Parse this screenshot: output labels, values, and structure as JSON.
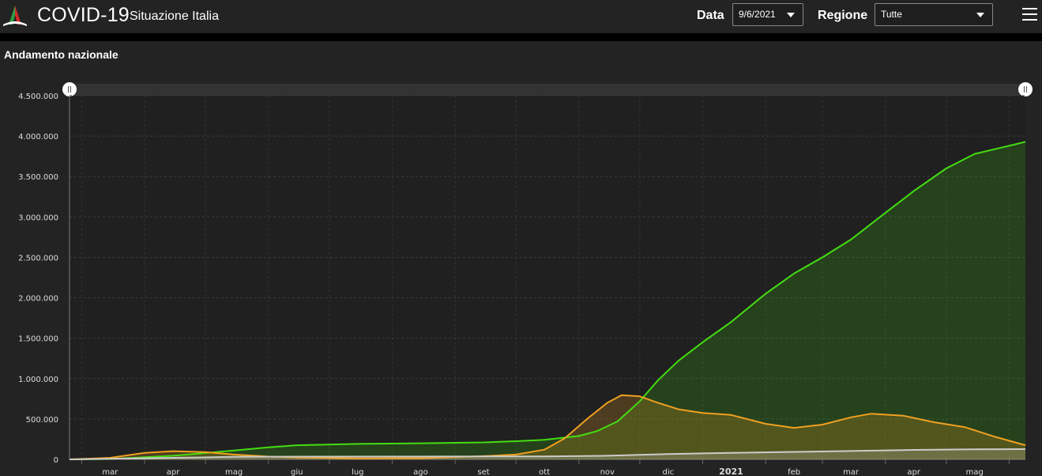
{
  "header": {
    "app_title": "COVID-19",
    "app_subtitle": "Situazione Italia",
    "data_label": "Data",
    "data_value": "9/6/2021",
    "regione_label": "Regione",
    "regione_value": "Tutte",
    "menu_icon": "hamburger-menu-icon",
    "logo_icon": "italy-tricolor-logo"
  },
  "section": {
    "title": "Andamento nazionale"
  },
  "colors": {
    "background": "#232323",
    "plot_background": "#202020",
    "green_series": "#44dd11",
    "orange_series": "#f0a020",
    "white_series": "#cccccc"
  },
  "chart_data": {
    "type": "area",
    "title": "",
    "xlabel": "",
    "ylabel": "",
    "ylim": [
      0,
      4500000
    ],
    "yticks": [
      {
        "value": 0,
        "label": "0"
      },
      {
        "value": 500000,
        "label": "500.000"
      },
      {
        "value": 1000000,
        "label": "1.000.000"
      },
      {
        "value": 1500000,
        "label": "1.500.000"
      },
      {
        "value": 2000000,
        "label": "2.000.000"
      },
      {
        "value": 2500000,
        "label": "2.500.000"
      },
      {
        "value": 3000000,
        "label": "3.000.000"
      },
      {
        "value": 3500000,
        "label": "3.500.000"
      },
      {
        "value": 4000000,
        "label": "4.000.000"
      },
      {
        "value": 4500000,
        "label": "4.500.000"
      }
    ],
    "xlim": [
      "2020-02-24",
      "2021-06-09"
    ],
    "xticks": [
      {
        "date": "2020-03-15",
        "label": "mar",
        "bold": false
      },
      {
        "date": "2020-04-15",
        "label": "apr",
        "bold": false
      },
      {
        "date": "2020-05-15",
        "label": "mag",
        "bold": false
      },
      {
        "date": "2020-06-15",
        "label": "giu",
        "bold": false
      },
      {
        "date": "2020-07-15",
        "label": "lug",
        "bold": false
      },
      {
        "date": "2020-08-15",
        "label": "ago",
        "bold": false
      },
      {
        "date": "2020-09-15",
        "label": "set",
        "bold": false
      },
      {
        "date": "2020-10-15",
        "label": "ott",
        "bold": false
      },
      {
        "date": "2020-11-15",
        "label": "nov",
        "bold": false
      },
      {
        "date": "2020-12-15",
        "label": "dic",
        "bold": false
      },
      {
        "date": "2021-01-15",
        "label": "2021",
        "bold": true
      },
      {
        "date": "2021-02-15",
        "label": "feb",
        "bold": false
      },
      {
        "date": "2021-03-15",
        "label": "mar",
        "bold": false
      },
      {
        "date": "2021-04-15",
        "label": "apr",
        "bold": false
      },
      {
        "date": "2021-05-15",
        "label": "mag",
        "bold": false
      }
    ],
    "grid": true,
    "series": [
      {
        "color": "#44dd11",
        "points": [
          [
            "2020-02-24",
            0
          ],
          [
            "2020-03-15",
            5000
          ],
          [
            "2020-04-15",
            45000
          ],
          [
            "2020-05-15",
            110000
          ],
          [
            "2020-06-01",
            150000
          ],
          [
            "2020-06-15",
            175000
          ],
          [
            "2020-07-15",
            192000
          ],
          [
            "2020-08-15",
            200000
          ],
          [
            "2020-09-15",
            210000
          ],
          [
            "2020-10-01",
            225000
          ],
          [
            "2020-10-15",
            242000
          ],
          [
            "2020-11-01",
            290000
          ],
          [
            "2020-11-10",
            350000
          ],
          [
            "2020-11-20",
            470000
          ],
          [
            "2020-12-01",
            720000
          ],
          [
            "2020-12-10",
            980000
          ],
          [
            "2020-12-20",
            1220000
          ],
          [
            "2021-01-01",
            1450000
          ],
          [
            "2021-01-15",
            1700000
          ],
          [
            "2021-02-01",
            2050000
          ],
          [
            "2021-02-15",
            2300000
          ],
          [
            "2021-03-01",
            2500000
          ],
          [
            "2021-03-15",
            2720000
          ],
          [
            "2021-04-01",
            3050000
          ],
          [
            "2021-04-15",
            3320000
          ],
          [
            "2021-05-01",
            3600000
          ],
          [
            "2021-05-15",
            3780000
          ],
          [
            "2021-06-01",
            3880000
          ],
          [
            "2021-06-09",
            3930000
          ]
        ]
      },
      {
        "color": "#f0a020",
        "points": [
          [
            "2020-02-24",
            0
          ],
          [
            "2020-03-15",
            20000
          ],
          [
            "2020-04-01",
            80000
          ],
          [
            "2020-04-15",
            102000
          ],
          [
            "2020-05-01",
            90000
          ],
          [
            "2020-05-15",
            60000
          ],
          [
            "2020-06-01",
            35000
          ],
          [
            "2020-06-15",
            24000
          ],
          [
            "2020-07-15",
            13000
          ],
          [
            "2020-08-15",
            15000
          ],
          [
            "2020-09-15",
            40000
          ],
          [
            "2020-10-01",
            60000
          ],
          [
            "2020-10-15",
            120000
          ],
          [
            "2020-10-25",
            260000
          ],
          [
            "2020-11-05",
            500000
          ],
          [
            "2020-11-15",
            700000
          ],
          [
            "2020-11-22",
            795000
          ],
          [
            "2020-12-01",
            780000
          ],
          [
            "2020-12-10",
            700000
          ],
          [
            "2020-12-20",
            620000
          ],
          [
            "2021-01-01",
            575000
          ],
          [
            "2021-01-15",
            550000
          ],
          [
            "2021-02-01",
            440000
          ],
          [
            "2021-02-15",
            390000
          ],
          [
            "2021-03-01",
            430000
          ],
          [
            "2021-03-15",
            520000
          ],
          [
            "2021-03-25",
            565000
          ],
          [
            "2021-04-10",
            540000
          ],
          [
            "2021-04-25",
            460000
          ],
          [
            "2021-05-10",
            400000
          ],
          [
            "2021-05-25",
            280000
          ],
          [
            "2021-06-09",
            175000
          ]
        ]
      },
      {
        "color": "#cccccc",
        "points": [
          [
            "2020-02-24",
            0
          ],
          [
            "2020-04-15",
            20000
          ],
          [
            "2020-05-15",
            31000
          ],
          [
            "2020-06-15",
            34000
          ],
          [
            "2020-08-15",
            35000
          ],
          [
            "2020-10-15",
            37000
          ],
          [
            "2020-11-15",
            45000
          ],
          [
            "2020-12-15",
            66000
          ],
          [
            "2021-01-15",
            81000
          ],
          [
            "2021-02-15",
            93000
          ],
          [
            "2021-03-15",
            104000
          ],
          [
            "2021-04-15",
            117000
          ],
          [
            "2021-05-15",
            125000
          ],
          [
            "2021-06-09",
            127000
          ]
        ]
      }
    ]
  }
}
